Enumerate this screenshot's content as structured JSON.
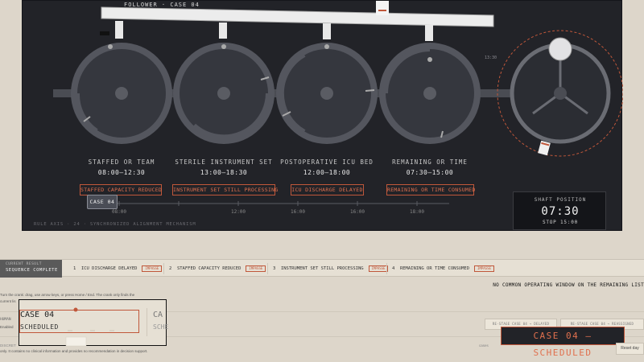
{
  "follower_label": "FOLLOWER · CASE 04",
  "cams": [
    {
      "label": "STAFFED OR TEAM",
      "time": "08:00–12:30",
      "status": "STAFFED CAPACITY REDUCED"
    },
    {
      "label": "STERILE INSTRUMENT SET",
      "time": "13:00–18:30",
      "status": "INSTRUMENT SET STILL PROCESSING"
    },
    {
      "label": "POSTOPERATIVE ICU BED",
      "time": "12:00–18:00",
      "status": "ICU DISCHARGE DELAYED"
    },
    {
      "label": "REMAINING OR TIME",
      "time": "07:30–15:00",
      "status": "REMAINING OR TIME CONSUMED"
    }
  ],
  "timeline": {
    "case_chip": "CASE 04",
    "ticks": [
      "08:00",
      "12:00",
      "16:00",
      "16:00",
      "18:00"
    ]
  },
  "axis_caption": "RULE AXIS · 24 · SYNCHRONIZED ALIGNMENT MECHANISM",
  "shaft": {
    "title": "SHAFT POSITION",
    "time": "07:30",
    "stop": "STOP 15:00",
    "dial_label": "13:30"
  },
  "sequence": {
    "head_small": "CURRENT RESULT",
    "head": "SEQUENCE COMPLETE",
    "items": [
      {
        "num": "1",
        "text": "ICU DISCHARGE DELAYED",
        "tag": "IMPASSE"
      },
      {
        "num": "2",
        "text": "STAFFED CAPACITY REDUCED",
        "tag": "IMPASSE"
      },
      {
        "num": "3",
        "text": "INSTRUMENT SET STILL PROCESSING",
        "tag": "IMPASSE"
      },
      {
        "num": "4",
        "text": "REMAINING OR TIME CONSUMED",
        "tag": "IMPASSE"
      }
    ]
  },
  "no_window": "NO COMMON OPERATING WINDOW ON THE REMAINING LIST",
  "instructions_line1": "Turn the crank: drag, use arrow keys, or press Home / End. The crank only finds the",
  "instructions_line2": "current lis",
  "human_label": "HUMAN",
  "human_sub": "Enabled",
  "zoom": {
    "case": "CASE 04",
    "state": "SCHEDULED",
    "ghost_case": "CA",
    "ghost_state": "SCHE"
  },
  "buttons": {
    "re_stage_1": "RE-STAGE CASE 04 → DELAYED",
    "re_stage_2": "RE-STAGE CASE 04 → REASSIGNED",
    "reset": "Reset day"
  },
  "status_banner": "CASE 04 — SCHEDULED",
  "disclaimer_line1": "DISCRET",
  "disclaimer_line2": "only. It contains no clinical information and provides no recommendation in decision support.",
  "disclaimer_right": "cases",
  "colors": {
    "panel": "#222328",
    "accent": "#e0704e",
    "cam": "#3a3d45",
    "page": "#ddd6ca"
  }
}
